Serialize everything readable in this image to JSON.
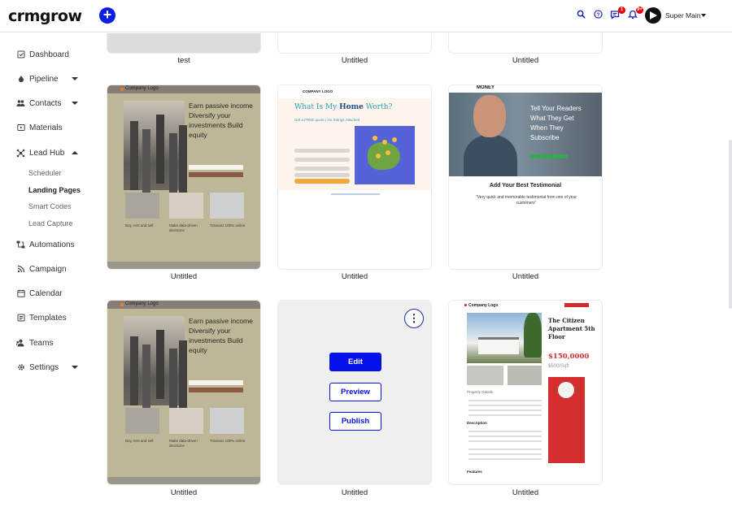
{
  "app": {
    "logo": "crmgrow",
    "add_label": "+"
  },
  "header": {
    "user_name": "Super Main",
    "badges": {
      "messages": "1",
      "notifications": "9+"
    },
    "icons": [
      "search-icon",
      "help-icon",
      "messages-icon",
      "notifications-icon",
      "profile-icon"
    ]
  },
  "sidebar": {
    "items": [
      {
        "label": "Dashboard",
        "icon": "checkbox-icon"
      },
      {
        "label": "Pipeline",
        "icon": "flame-icon",
        "caret": "down"
      },
      {
        "label": "Contacts",
        "icon": "people-icon",
        "caret": "down"
      },
      {
        "label": "Materials",
        "icon": "video-icon"
      },
      {
        "label": "Lead Hub",
        "icon": "hub-icon",
        "caret": "up"
      },
      {
        "label": "Automations",
        "icon": "flow-icon"
      },
      {
        "label": "Campaign",
        "icon": "rss-icon"
      },
      {
        "label": "Calendar",
        "icon": "calendar-icon"
      },
      {
        "label": "Templates",
        "icon": "template-icon"
      },
      {
        "label": "Teams",
        "icon": "team-icon"
      },
      {
        "label": "Settings",
        "icon": "gear-icon",
        "caret": "down"
      }
    ],
    "lead_hub_sub": [
      {
        "label": "Scheduler"
      },
      {
        "label": "Landing Pages",
        "active": true
      },
      {
        "label": "Smart Codes"
      },
      {
        "label": "Lead Capture"
      }
    ]
  },
  "pages": {
    "row0": [
      "test",
      "Untitled",
      "Untitled"
    ],
    "row1": [
      "Untitled",
      "Untitled",
      "Untitled"
    ],
    "row2": [
      "Untitled",
      "Untitled",
      "Untitled"
    ]
  },
  "thumbs": {
    "company_logo": "Company Logo",
    "earn_headline": "Earn passive income Diversify your investments Build equity",
    "captions": [
      "Buy, rent and sell",
      "Make data-driven decisions",
      "Transact 100% online"
    ],
    "worth_logo": "COMPANY LOGO",
    "worth_q": "What Is My ",
    "worth_q_bold": "Home",
    "worth_q_end": " Worth?",
    "worth_sub": "Get a FREE quote | No Strings Attached",
    "money_logo": "MONEY",
    "money_headline": "Tell Your Readers What They Get When They Subscribe",
    "money_testimonial_title": "Add Your Best Testimonial",
    "money_quote": "\"Very quick and memorable testimonial from one of your customers\"",
    "estate_logo": "Company Logo",
    "estate_title": "The Citizen Apartment 5th Floor",
    "estate_price": "$150,0000",
    "estate_sqft": "$500/Sqft",
    "estate_details": "Property Details",
    "estate_description": "Description",
    "estate_features": "Features"
  },
  "hover_menu": {
    "more": "⋮",
    "edit": "Edit",
    "preview": "Preview",
    "publish": "Publish"
  },
  "colors": {
    "accent": "#0511ea",
    "brand_blue": "#0b1fe0",
    "badge_red": "#e00000"
  }
}
